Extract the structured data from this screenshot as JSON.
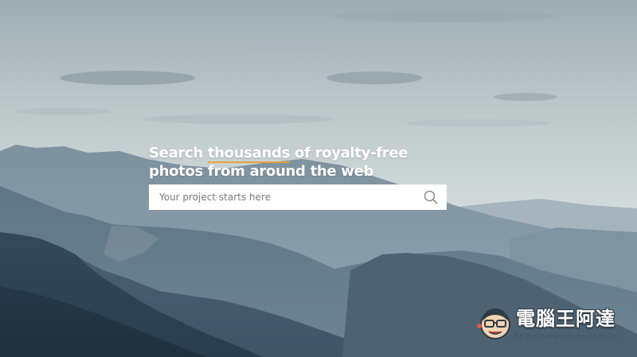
{
  "hero": {
    "headline_part1": "Search ",
    "headline_highlight": "thousands",
    "headline_part2": " of royalty-free",
    "headline_line2": "photos from around the web",
    "highlight_color": "#e8a23a"
  },
  "search": {
    "placeholder": "Your project starts here",
    "value": "",
    "icon": "search-icon"
  },
  "watermark": {
    "title": "電腦王阿達",
    "url": "http://www.kocpc.com.tw",
    "icon": "mascot-face-icon"
  }
}
